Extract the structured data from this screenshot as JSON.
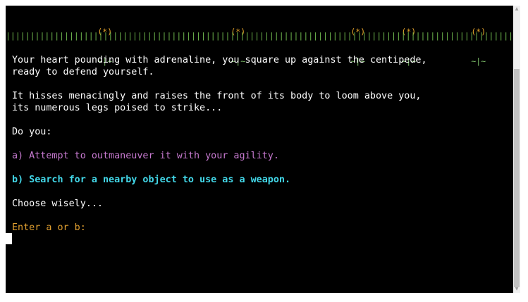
{
  "scene": {
    "flower_head": "(*)",
    "flower_stem": "~|~",
    "grass": "||||||||||||||||||||||||||||||||||||||||||||||||||||||||||||||||||||||||||||||||||||||||||||||||||||||||||||||||||"
  },
  "story": {
    "line1": "Your heart pounding with adrenaline, you square up against the centipede,",
    "line2": "ready to defend yourself.",
    "line3": "It hisses menacingly and raises the front of its body to loom above you,",
    "line4": "its numerous legs poised to strike...",
    "line5": "Do you:",
    "option_a": "a) Attempt to outmaneuver it with your agility.",
    "option_b": "b) Search for a nearby object to use as a weapon.",
    "line6": "Choose wisely...",
    "prompt": "Enter a or b:"
  },
  "colors": {
    "background": "#000000",
    "text": "#ffffff",
    "flower_head": "#e5a32a",
    "flower_stem": "#7ec06a",
    "grass": "#6fb84e",
    "option_a": "#c77ad0",
    "option_b": "#42d7e8",
    "prompt": "#e2a030"
  }
}
